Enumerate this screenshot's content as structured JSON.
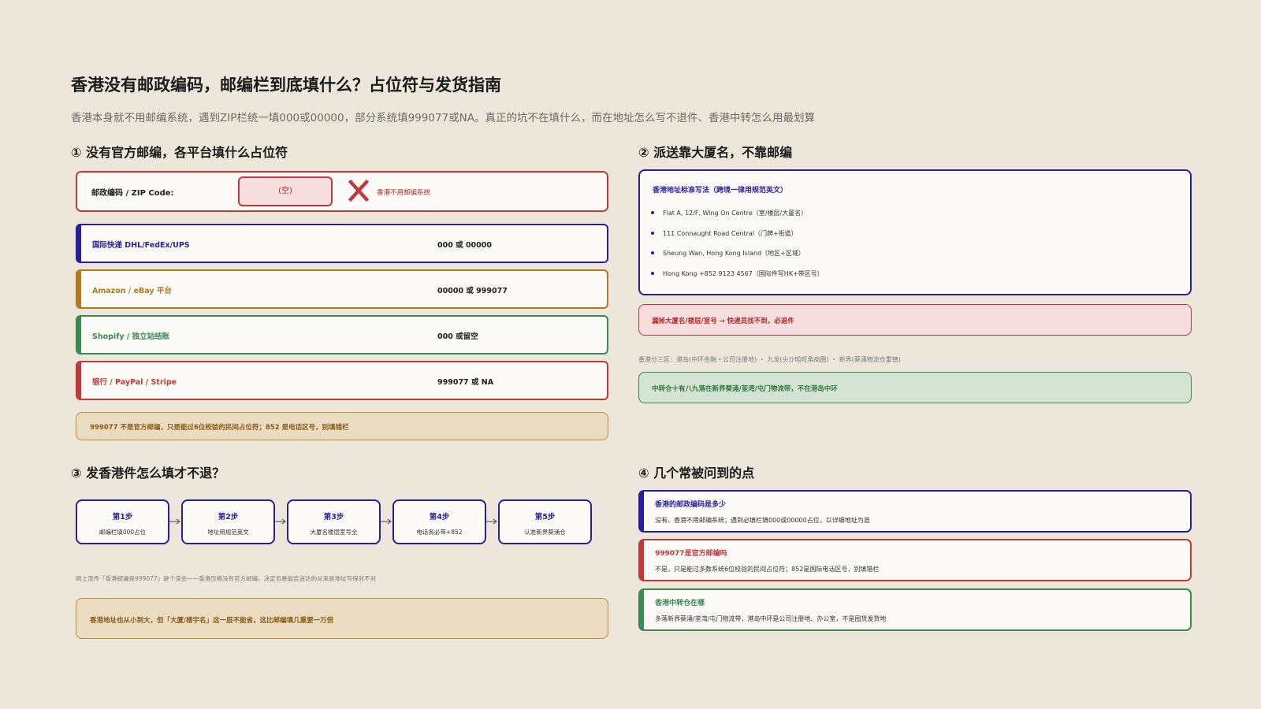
{
  "header": {
    "title": "香港没有邮政编码，邮编栏到底填什么？占位符与发货指南",
    "subtitle": "香港本身就不用邮编系统，遇到ZIP栏统一填000或00000，部分系统填999077或NA。真正的坑不在填什么，而在地址怎么写不退件、香港中转怎么用最划算"
  },
  "section1": {
    "title": "① 没有官方邮编，各平台填什么占位符",
    "zip_label": "邮政编码 / ZIP Code:",
    "zip_value": "(空)",
    "zip_note": "香港不用邮编系统",
    "platforms": [
      {
        "name": "国际快递 DHL/FedEx/UPS",
        "value": "000 或 00000",
        "color": "#2a1ea0"
      },
      {
        "name": "Amazon / eBay 平台",
        "value": "00000 或 999077",
        "color": "#b07a1e"
      },
      {
        "name": "Shopify / 独立站结账",
        "value": "000 或留空",
        "color": "#3a8a52"
      },
      {
        "name": "银行 / PayPal / Stripe",
        "value": "999077 或 NA",
        "color": "#c0393b"
      }
    ],
    "note": "999077 不是官方邮编，只是能过6位校验的民间占位符；852 是电话区号，别填错栏"
  },
  "section2": {
    "title": "② 派送靠大厦名，不靠邮编",
    "address_heading": "香港地址标准写法（跨境一律用规范英文）",
    "address_lines": [
      "Flat A, 12/F, Wing On Centre（室/楼层/大厦名）",
      "111 Connaught Road Central（门牌+街道）",
      "Sheung Wan, Hong Kong Island（地区+区域）",
      "Hong Kong  +852 9123 4567（国际件写HK+带区号）"
    ],
    "warning": "漏掉大厦名/楼层/室号 → 快递员找不到，必退件",
    "districts": "香港分三区：港岛(中环金融・公司注册地) ・ 九龙(尖沙咀旺角商圈) ・ 新界(葵涌物流仓重镇)",
    "transit": "中转仓十有八九落在新界葵涌/荃湾/屯门物流带，不在港岛中环"
  },
  "section3": {
    "title": "③ 发香港件怎么填才不退？",
    "steps": [
      {
        "title": "第1步",
        "desc": "邮编栏填000占位"
      },
      {
        "title": "第2步",
        "desc": "地址用规范英文"
      },
      {
        "title": "第3步",
        "desc": "大厦名楼层室号全"
      },
      {
        "title": "第4步",
        "desc": "电话务必带+852"
      },
      {
        "title": "第5步",
        "desc": "认准新界葵涌仓"
      }
    ],
    "myth": "网上流传「香港邮编是999077」是个误会——香港压根没有官方邮编，决定包裹能否送达的从来是地址写得对不对",
    "note": "香港地址也从小到大，但「大厦/楼宇名」这一层不能省，这比邮编填几重要一万倍"
  },
  "section4": {
    "title": "④ 几个常被问到的点",
    "faqs": [
      {
        "q": "香港的邮政编码是多少",
        "a": "没有，香港不用邮编系统；遇到必填栏填000或00000占位，以详细地址为准",
        "color": "#2a1ea0"
      },
      {
        "q": "999077是官方邮编吗",
        "a": "不是，只是能过多数系统6位校验的民间占位符；852是国际电话区号，别填错栏",
        "color": "#c0393b"
      },
      {
        "q": "香港中转仓在哪",
        "a": "多落新界葵涌/荃湾/屯门物流带，港岛中环是公司注册地、办公室，不是囤货发货地",
        "color": "#3a8a52"
      }
    ]
  }
}
